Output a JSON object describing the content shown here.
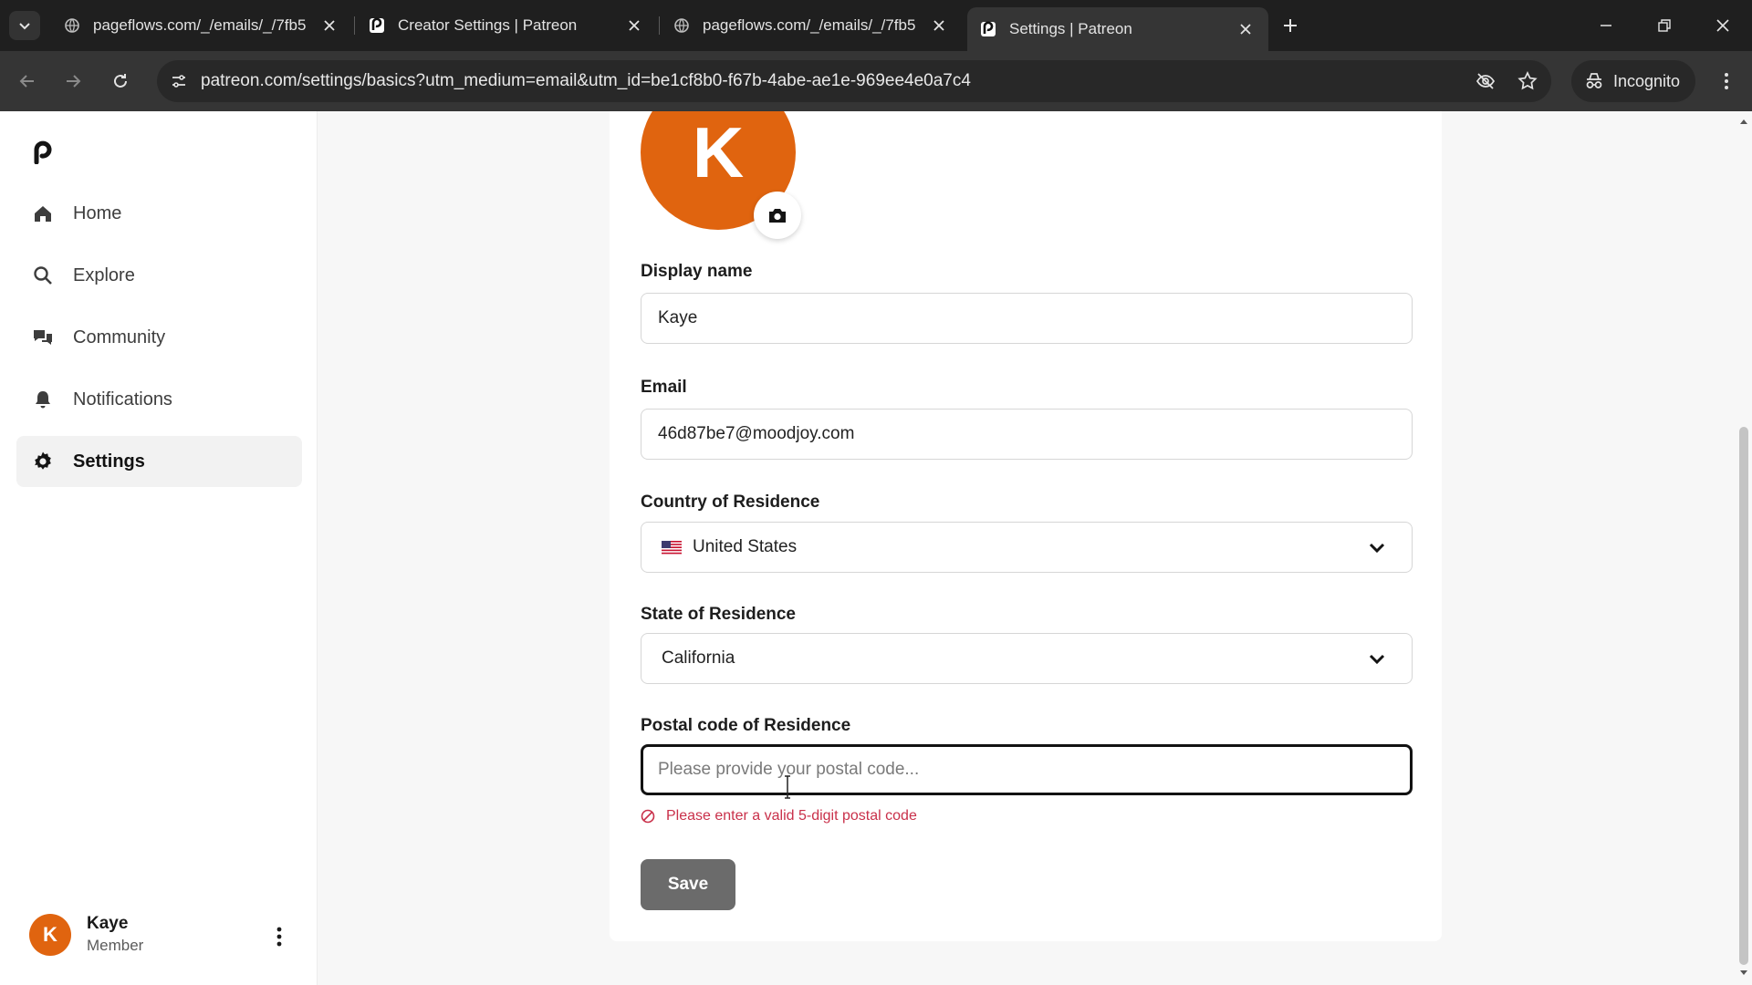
{
  "browser": {
    "tabs": [
      {
        "title": "pageflows.com/_/emails/_/7fb5",
        "active": false,
        "favicon": "globe-icon"
      },
      {
        "title": "Creator Settings | Patreon",
        "active": false,
        "favicon": "patreon-icon"
      },
      {
        "title": "pageflows.com/_/emails/_/7fb5",
        "active": false,
        "favicon": "globe-icon"
      },
      {
        "title": "Settings | Patreon",
        "active": true,
        "favicon": "patreon-icon"
      }
    ],
    "url": "patreon.com/settings/basics?utm_medium=email&utm_id=be1cf8b0-f67b-4abe-ae1e-969ee4e0a7c4",
    "incognito_label": "Incognito"
  },
  "sidebar": {
    "items": [
      {
        "label": "Home",
        "icon": "home-icon",
        "active": false
      },
      {
        "label": "Explore",
        "icon": "search-icon",
        "active": false
      },
      {
        "label": "Community",
        "icon": "chat-bubbles-icon",
        "active": false
      },
      {
        "label": "Notifications",
        "icon": "bell-icon",
        "active": false
      },
      {
        "label": "Settings",
        "icon": "gear-icon",
        "active": true
      }
    ],
    "user": {
      "initial": "K",
      "name": "Kaye",
      "role": "Member"
    }
  },
  "form": {
    "avatar_initial": "K",
    "display_name": {
      "label": "Display name",
      "value": "Kaye"
    },
    "email": {
      "label": "Email",
      "value": "46d87be7@moodjoy.com"
    },
    "country": {
      "label": "Country of Residence",
      "value": "United States"
    },
    "state": {
      "label": "State of Residence",
      "value": "California"
    },
    "postal": {
      "label": "Postal code of Residence",
      "placeholder": "Please provide your postal code...",
      "value": ""
    },
    "error": "Please enter a valid 5-digit postal code",
    "save_label": "Save"
  },
  "colors": {
    "avatar": "#e0640f",
    "error": "#c9304a",
    "save_button": "#6b6b6b"
  }
}
